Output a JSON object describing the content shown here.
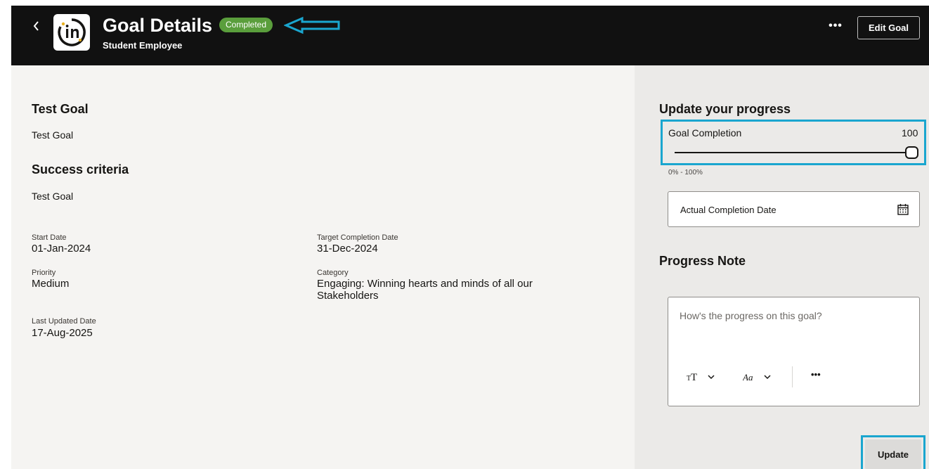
{
  "header": {
    "title": "Goal Details",
    "status": "Completed",
    "subtitle": "Student Employee",
    "more_label": "•••",
    "edit_label": "Edit Goal"
  },
  "goal": {
    "title_heading": "Test Goal",
    "title_value": "Test Goal",
    "criteria_heading": "Success criteria",
    "criteria_value": "Test Goal",
    "fields": {
      "start_date": {
        "label": "Start Date",
        "value": "01-Jan-2024"
      },
      "target_date": {
        "label": "Target Completion Date",
        "value": "31-Dec-2024"
      },
      "priority": {
        "label": "Priority",
        "value": "Medium"
      },
      "category": {
        "label": "Category",
        "value": "Engaging: Winning hearts and minds of all our Stakeholders"
      },
      "last_updated": {
        "label": "Last Updated Date",
        "value": "17-Aug-2025"
      }
    }
  },
  "progress": {
    "heading": "Update your progress",
    "completion_label": "Goal Completion",
    "completion_value": "100",
    "completion_fraction": 1.0,
    "range_hint": "0% - 100%",
    "date_placeholder": "Actual Completion Date",
    "note_heading": "Progress Note",
    "note_placeholder": "How's the progress on this goal?",
    "toolbar": {
      "more": "•••"
    },
    "update_label": "Update"
  },
  "colors": {
    "header_bg": "#111111",
    "status_green": "#5a9e3c",
    "annotation_blue": "#1aa6cf",
    "main_bg": "#f5f4f2",
    "side_bg": "#ebeae8"
  }
}
